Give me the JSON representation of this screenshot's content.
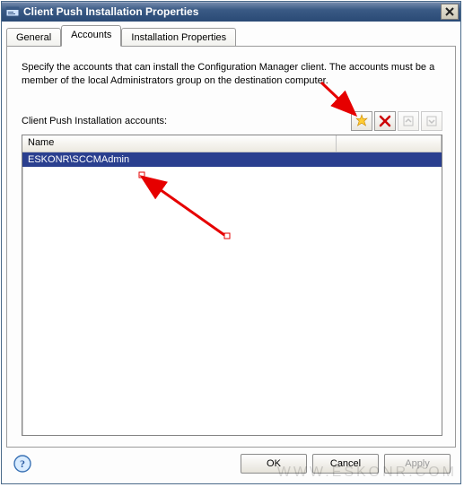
{
  "window": {
    "title": "Client Push Installation Properties"
  },
  "tabs": {
    "general": "General",
    "accounts": "Accounts",
    "installation": "Installation Properties"
  },
  "description": "Specify the accounts that can install the Configuration Manager client. The accounts must be a member of the local Administrators group on the destination computer.",
  "accounts": {
    "label": "Client Push Installation accounts:",
    "header_name": "Name",
    "rows": [
      {
        "name": "ESKONR\\SCCMAdmin"
      }
    ]
  },
  "toolbar_icons": {
    "new": "new-star-icon",
    "delete": "delete-x-icon",
    "move_up": "move-up-icon",
    "move_down": "move-down-icon"
  },
  "buttons": {
    "ok": "OK",
    "cancel": "Cancel",
    "apply": "Apply"
  },
  "watermark": "WWW.ESKONR.COM"
}
